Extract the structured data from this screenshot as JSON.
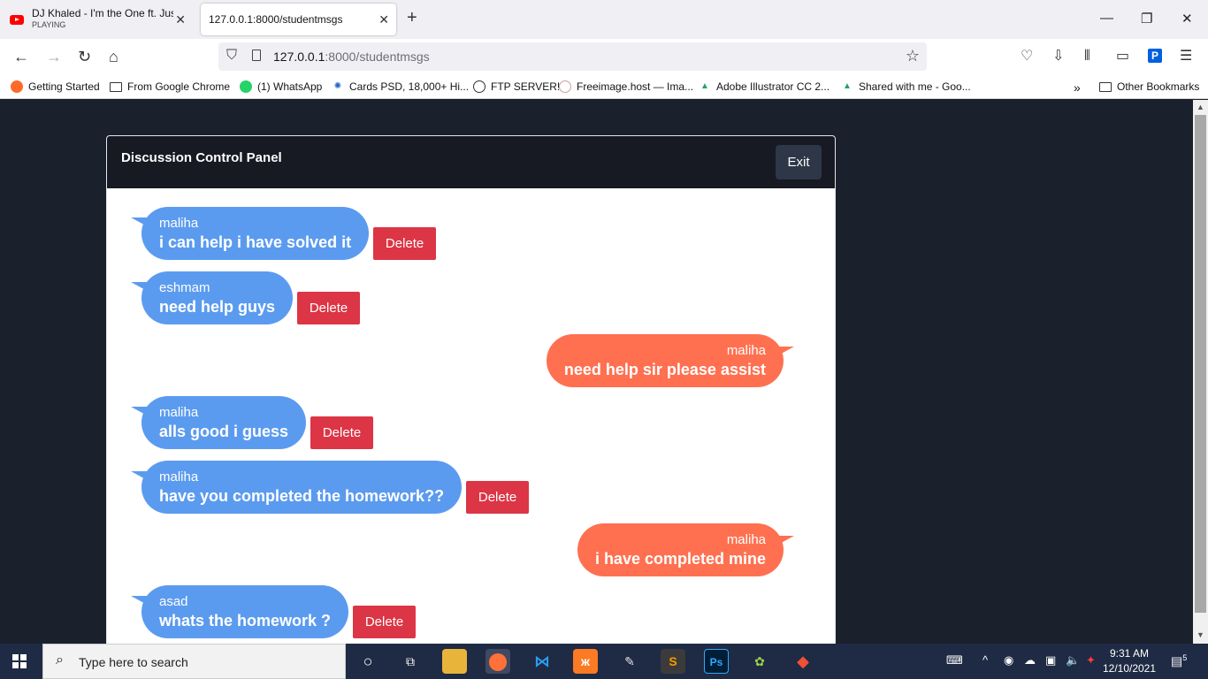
{
  "browser": {
    "tabs": [
      {
        "title": "DJ Khaled - I'm the One ft. Justi",
        "subtitle": "PLAYING"
      },
      {
        "title": "127.0.0.1:8000/studentmsgs"
      }
    ],
    "url_host": "127.0.0.1",
    "url_path": ":8000/studentmsgs",
    "bookmarks": [
      "Getting Started",
      "From Google Chrome",
      "(1) WhatsApp",
      "Cards PSD, 18,000+ Hi...",
      "FTP SERVER!",
      "Freeimage.host — Ima...",
      "Adobe Illustrator CC 2...",
      "Shared with me - Goo...",
      "Other Bookmarks"
    ]
  },
  "panel": {
    "title": "Discussion Control Panel",
    "exit_label": "Exit"
  },
  "messages": [
    {
      "user": "maliha",
      "text": "i can help i have solved it",
      "side": "left",
      "delete_label": "Delete"
    },
    {
      "user": "eshmam",
      "text": "need help guys",
      "side": "left",
      "delete_label": "Delete"
    },
    {
      "user": "maliha",
      "text": "need help sir please assist",
      "side": "right"
    },
    {
      "user": "maliha",
      "text": "alls good i guess",
      "side": "left",
      "delete_label": "Delete"
    },
    {
      "user": "maliha",
      "text": "have you completed the homework??",
      "side": "left",
      "delete_label": "Delete"
    },
    {
      "user": "maliha",
      "text": "i have completed mine",
      "side": "right"
    },
    {
      "user": "asad",
      "text": "whats the homework ?",
      "side": "left",
      "delete_label": "Delete"
    }
  ],
  "colors": {
    "received_bubble": "#5b9bef",
    "sent_bubble": "#ff7050",
    "delete_button": "#dc3545",
    "header": "#171923"
  },
  "taskbar": {
    "search_placeholder": "Type here to search",
    "time": "9:31 AM",
    "date": "12/10/2021",
    "notification_count": "5"
  }
}
